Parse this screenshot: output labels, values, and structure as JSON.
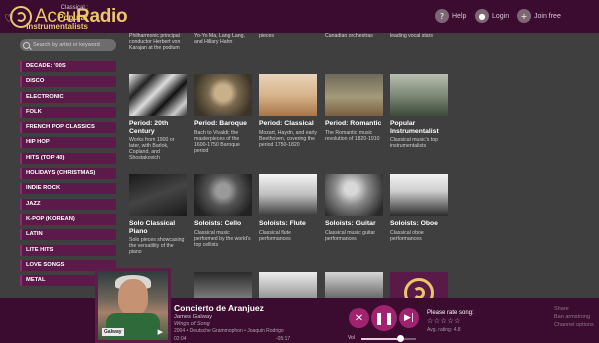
{
  "header": {
    "logo_text_light": "Accu",
    "logo_text_bold": "Radio",
    "help": "Help",
    "login": "Login",
    "join": "Join free"
  },
  "search": {
    "placeholder": "Search by artist or keyword"
  },
  "genres": [
    "DECADE: '00S",
    "DISCO",
    "ELECTRONIC",
    "FOLK",
    "FRENCH POP CLASSICS",
    "HIP HOP",
    "HITS (TOP 40)",
    "HOLIDAYS (CHRISTMAS)",
    "INDIE ROCK",
    "JAZZ",
    "K-POP (KOREAN)",
    "LATIN",
    "LITE HITS",
    "LOVE SONGS",
    "METAL"
  ],
  "top_fragments": [
    "Philharmonic principal conductor Herbert von Karajan at the podium",
    "Yo-Yo Ma, Lang Lang, and Hillary Hahn",
    "pieces",
    "Canadian orchestras",
    "leading vocal stars"
  ],
  "tiles_row1": [
    {
      "title": "Period: 20th Century",
      "desc": "Works from 1900 or later, with Barlok, Copland, and Shostakovich"
    },
    {
      "title": "Period: Baroque",
      "desc": "Bach to Vivaldi; the masterpieces of the 1600-1750 Baroque period"
    },
    {
      "title": "Period: Classical",
      "desc": "Mozart, Haydn, and early Beethoven, covering the period 1750-1820"
    },
    {
      "title": "Period: Romantic",
      "desc": "The Romantic music revolution of 1820-1910"
    },
    {
      "title": "Popular Instrumentalist",
      "desc": "Classical music's top instrumentalists"
    }
  ],
  "tiles_row2": [
    {
      "title": "Solo Classical Piano",
      "desc": "Solo pieces showcasing the versatility of the piano"
    },
    {
      "title": "Soloists: Cello",
      "desc": "Classical music performed by the world's top cellists"
    },
    {
      "title": "Soloists: Flute",
      "desc": "Classical flute performances"
    },
    {
      "title": "Soloists: Guitar",
      "desc": "Classical music guitar performances"
    },
    {
      "title": "Soloists: Oboe",
      "desc": "Classical oboe performances"
    }
  ],
  "player": {
    "channel_label": "Classical :",
    "channel_name": "Popular Instrumentalists",
    "song": "Concierto de Aranjuez",
    "artist": "James Galway",
    "album": "Wings of Song",
    "album_info": "2004 • Deutsche Grammophon • Joaquin Rodrigo",
    "album_tag": "Galway",
    "time_current": "02:04",
    "time_end": "-05:17",
    "volume_label": "Vol",
    "volume": 0.7,
    "rate_label": "Please rate song:",
    "stars": "☆☆☆☆☆",
    "avg_rating": "Avg. rating: 4.8",
    "links": [
      "Share",
      "Ban armstrong",
      "Channel options"
    ]
  },
  "colors": {
    "accent": "#a0236f",
    "header": "#3b0c2f",
    "gold": "#e9c76a",
    "background": "#3f3f3f"
  }
}
